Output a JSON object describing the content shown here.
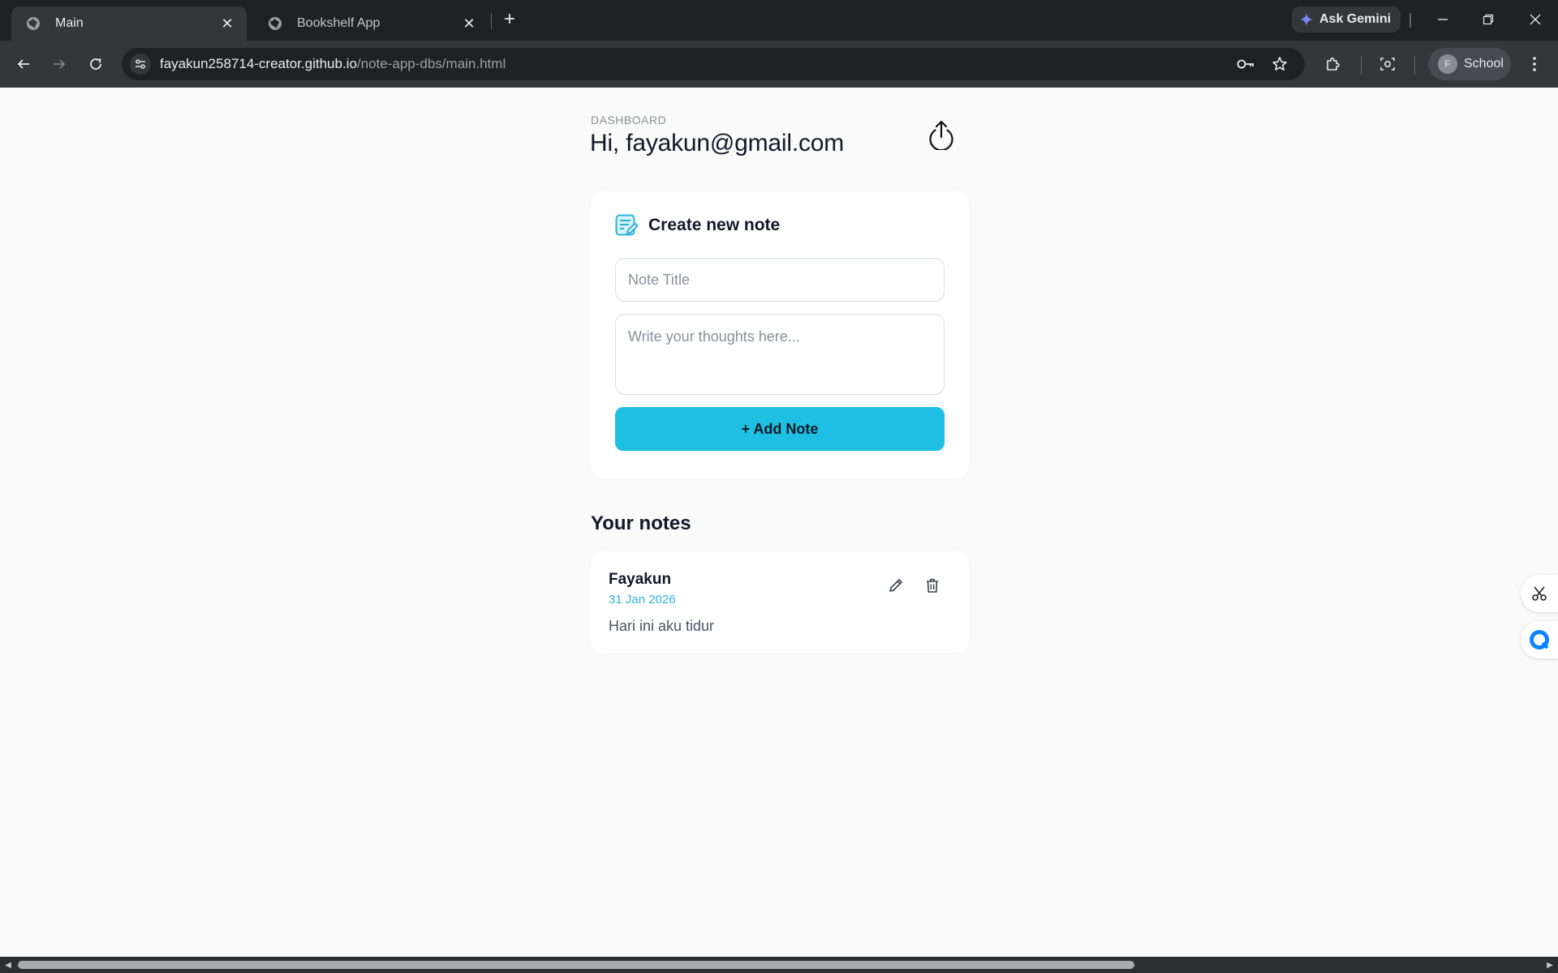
{
  "browser": {
    "tabs": [
      {
        "title": "Main",
        "active": true
      },
      {
        "title": "Bookshelf App",
        "active": false
      }
    ],
    "gemini_label": "Ask Gemini",
    "url_host": "fayakun258714-creator.github.io",
    "url_path": "/note-app-dbs/main.html",
    "profile_initial": "F",
    "profile_label": "School"
  },
  "dashboard": {
    "eyebrow": "DASHBOARD",
    "greeting": "Hi, fayakun@gmail.com"
  },
  "create_note": {
    "heading": "Create new note",
    "title_placeholder": "Note Title",
    "body_placeholder": "Write your thoughts here...",
    "add_button_label": "+ Add Note"
  },
  "notes_section": {
    "heading": "Your notes",
    "notes": [
      {
        "title": "Fayakun",
        "date": "31 Jan 2026",
        "body": "Hari ini aku tidur"
      }
    ]
  },
  "colors": {
    "accent": "#1ebfe3",
    "date": "#2bb3d8",
    "page_background": "#fafafa",
    "chrome_dark": "#202124",
    "chrome_toolbar": "#35363a"
  }
}
